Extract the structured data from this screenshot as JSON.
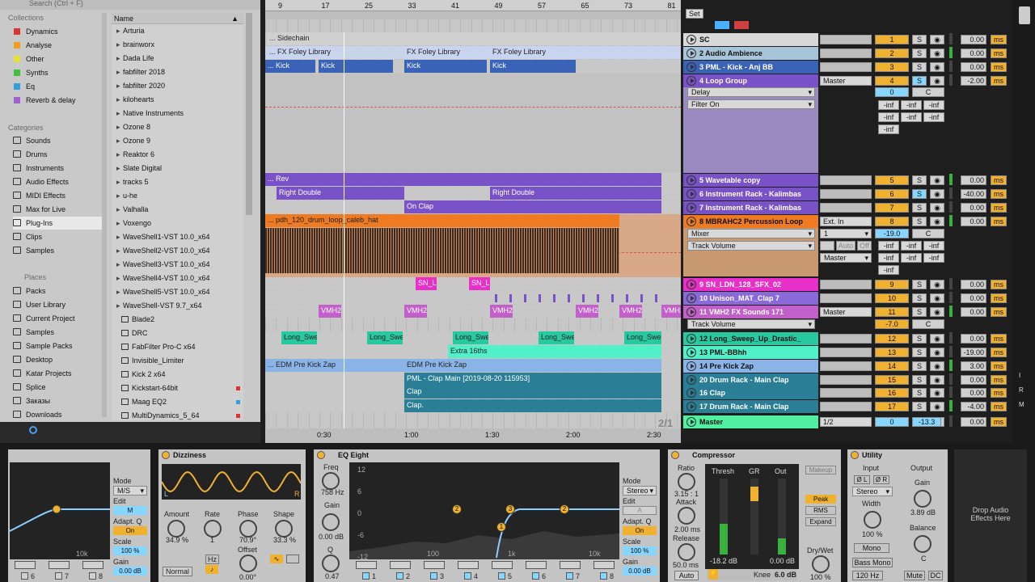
{
  "browser": {
    "search_placeholder": "Search (Ctrl + F)",
    "collections_title": "Collections",
    "collections": [
      {
        "label": "Dynamics",
        "color": "#e03030"
      },
      {
        "label": "Analyse",
        "color": "#f0a020"
      },
      {
        "label": "Other",
        "color": "#e8e030"
      },
      {
        "label": "Synths",
        "color": "#40c040"
      },
      {
        "label": "Eq",
        "color": "#30a0e0"
      },
      {
        "label": "Reverb & delay",
        "color": "#a060d0"
      }
    ],
    "categories_title": "Categories",
    "categories": [
      "Sounds",
      "Drums",
      "Instruments",
      "Audio Effects",
      "MIDI Effects",
      "Max for Live",
      "Plug-Ins",
      "Clips",
      "Samples"
    ],
    "selected_category": "Plug-Ins",
    "places_title": "Places",
    "places": [
      "Packs",
      "User Library",
      "Current Project",
      "Samples",
      "Sample Packs",
      "Desktop",
      "Katar Projects",
      "Splice",
      "Заказы",
      "Downloads"
    ],
    "name_header": "Name",
    "items": [
      {
        "label": "Arturia",
        "kind": "folder"
      },
      {
        "label": "brainworx",
        "kind": "folder"
      },
      {
        "label": "Dada Life",
        "kind": "folder"
      },
      {
        "label": "fabfilter 2018",
        "kind": "folder"
      },
      {
        "label": "fabfilter 2020",
        "kind": "folder"
      },
      {
        "label": "kilohearts",
        "kind": "folder"
      },
      {
        "label": "Native Instruments",
        "kind": "folder"
      },
      {
        "label": "Ozone 8",
        "kind": "folder"
      },
      {
        "label": "Ozone 9",
        "kind": "folder"
      },
      {
        "label": "Reaktor 6",
        "kind": "folder"
      },
      {
        "label": "Slate Digital",
        "kind": "folder"
      },
      {
        "label": "tracks 5",
        "kind": "folder"
      },
      {
        "label": "u-he",
        "kind": "folder"
      },
      {
        "label": "Valhalla",
        "kind": "folder"
      },
      {
        "label": "Voxengo",
        "kind": "folder"
      },
      {
        "label": "WaveShell1-VST 10.0_x64",
        "kind": "folder"
      },
      {
        "label": "WaveShell2-VST 10.0_x64",
        "kind": "folder"
      },
      {
        "label": "WaveShell3-VST 10.0_x64",
        "kind": "folder"
      },
      {
        "label": "WaveShell4-VST 10.0_x64",
        "kind": "folder"
      },
      {
        "label": "WaveShell5-VST 10.0_x64",
        "kind": "folder"
      },
      {
        "label": "WaveShell-VST 9.7_x64",
        "kind": "folder"
      },
      {
        "label": "Blade2",
        "kind": "plugin"
      },
      {
        "label": "DRC",
        "kind": "plugin"
      },
      {
        "label": "FabFilter Pro-C x64",
        "kind": "plugin"
      },
      {
        "label": "Invisible_Limiter",
        "kind": "plugin"
      },
      {
        "label": "Kick 2 x64",
        "kind": "plugin"
      },
      {
        "label": "Kickstart-64bit",
        "kind": "plugin",
        "dot": "#e03030"
      },
      {
        "label": "Maag EQ2",
        "kind": "plugin",
        "dot": "#30a0e0"
      },
      {
        "label": "MultiDynamics_5_64",
        "kind": "plugin",
        "dot": "#e03030"
      }
    ]
  },
  "arrangement": {
    "bars": [
      "9",
      "17",
      "25",
      "33",
      "41",
      "49",
      "57",
      "65",
      "73",
      "81"
    ],
    "times": [
      "0:30",
      "1:00",
      "1:30",
      "2:00",
      "2:30"
    ],
    "set_label": "Set",
    "loop_label": "2/1",
    "clips": [
      {
        "label": "... Sidechain",
        "lane": 0
      },
      {
        "label": "... FX Foley Library",
        "lane": 1
      },
      {
        "label": "FX Foley Library",
        "lane": 1
      },
      {
        "label": "FX Foley Library",
        "lane": 1
      },
      {
        "label": "... Kick",
        "lane": 2
      },
      {
        "label": "Kick",
        "lane": 2
      },
      {
        "label": "Kick",
        "lane": 2
      },
      {
        "label": "Kick",
        "lane": 2
      },
      {
        "label": "... Rev",
        "lane": 3
      },
      {
        "label": "Right Double",
        "lane": 4
      },
      {
        "label": "Right Double",
        "lane": 4
      },
      {
        "label": "On Clap",
        "lane": 5
      },
      {
        "label": "... pdh_120_drum_loop_caleb_hat",
        "lane": 6
      },
      {
        "label": "SN_LI",
        "lane": 7
      },
      {
        "label": "SN_LI",
        "lane": 7
      },
      {
        "label": "VMH2",
        "lane": 9
      },
      {
        "label": "VMH2",
        "lane": 9
      },
      {
        "label": "VMH2",
        "lane": 9
      },
      {
        "label": "VMH2",
        "lane": 9
      },
      {
        "label": "VMH2",
        "lane": 9
      },
      {
        "label": "VMH2",
        "lane": 9
      },
      {
        "label": "Long_Swe",
        "lane": 10
      },
      {
        "label": "Long_Swe",
        "lane": 10
      },
      {
        "label": "Long_Swe",
        "lane": 10
      },
      {
        "label": "Long_Swe",
        "lane": 10
      },
      {
        "label": "Long_Swe",
        "lane": 10
      },
      {
        "label": "Extra 16ths",
        "lane": 11
      },
      {
        "label": "... EDM Pre Kick Zap",
        "lane": 12
      },
      {
        "label": "EDM Pre Kick Zap",
        "lane": 12
      },
      {
        "label": "PML - Clap Main [2019-08-20 115953]",
        "lane": 13
      },
      {
        "label": "Clap",
        "lane": 14
      },
      {
        "label": "Clap.",
        "lane": 15
      }
    ]
  },
  "tracks": [
    {
      "name": "SC",
      "color": "#d8d8d8",
      "num": "1",
      "vol": "0.00"
    },
    {
      "name": "2 Audio Ambience",
      "color": "#a8c4d8",
      "num": "2",
      "vol": "0.00"
    },
    {
      "name": "3 PML - Kick - Anj BB",
      "color": "#3a63b8",
      "num": "3",
      "vol": "0.00"
    },
    {
      "name": "4 Loop Group",
      "color": "#7a52c8",
      "num": "4",
      "vol": "-2.00",
      "io": "Master"
    },
    {
      "name": "5 Wavetable copy",
      "color": "#7a52c8",
      "num": "5",
      "vol": "0.00"
    },
    {
      "name": "6 Instrument Rack - Kalimbas",
      "color": "#7a52c8",
      "num": "6",
      "vol": "-40.00"
    },
    {
      "name": "7 Instrument Rack - Kalimbas",
      "color": "#7a52c8",
      "num": "7",
      "vol": "0.00"
    },
    {
      "name": "8 MBRAHC2 Percussion Loop",
      "color": "#ee7a22",
      "num": "8",
      "vol": "0.00",
      "io": "Ext. In"
    },
    {
      "name": "9 SN_LDN_128_SFX_02",
      "color": "#e830c8",
      "num": "9",
      "vol": "0.00"
    },
    {
      "name": "10 Unison_MAT_Clap 7",
      "color": "#8a6ad8",
      "num": "10",
      "vol": "0.00"
    },
    {
      "name": "11 VMH2 FX Sounds 171",
      "color": "#c060c8",
      "num": "11",
      "vol": "0.00",
      "io": "Master"
    },
    {
      "name": "12 Long_Sweep_Up_Drastic_",
      "color": "#28c8a0",
      "num": "12",
      "vol": "0.00"
    },
    {
      "name": "13 PML-BBhh",
      "color": "#50f0c8",
      "num": "13",
      "vol": "-19.00"
    },
    {
      "name": "14 Pre Kick Zap",
      "color": "#8ab4e8",
      "num": "14",
      "vol": "3.00"
    },
    {
      "name": "20 Drum Rack - Main Clap",
      "color": "#2a7e96",
      "num": "15",
      "vol": "0.00"
    },
    {
      "name": "16 Clap",
      "color": "#2a7e96",
      "num": "16",
      "vol": "0.00"
    },
    {
      "name": "17 Drum Rack - Main Clap",
      "color": "#2a7e96",
      "num": "17",
      "vol": "-4.00"
    },
    {
      "name": "Master",
      "color": "#50f0a0",
      "num": "0",
      "vol": "0.00",
      "io": "1/2",
      "pan": "-13.3"
    }
  ],
  "group4": {
    "param1": "Delay",
    "param2": "Filter On",
    "send": "0",
    "pan": "C",
    "infs": [
      "-inf",
      "-inf",
      "-inf",
      "-inf",
      "-inf",
      "-inf",
      "-inf"
    ]
  },
  "group8": {
    "param1": "Mixer",
    "param2": "Track Volume",
    "io2": "1",
    "io3": "Master",
    "auto": "Auto",
    "off": "Off",
    "send": "-19.0",
    "pan": "C",
    "infs": [
      "-inf",
      "-inf",
      "-inf",
      "-inf",
      "-inf",
      "-inf",
      "-inf"
    ]
  },
  "group11": {
    "param1": "Track Volume",
    "send": "-7.0",
    "pan": "C"
  },
  "ms_label": "ms",
  "s_label": "S",
  "c_label": "C",
  "devices": {
    "eq_left": {
      "mode_label": "Mode",
      "mode": "M/S",
      "edit_label": "Edit",
      "edit": "M",
      "adapt_label": "Adapt. Q",
      "adapt": "On",
      "scale_label": "Scale",
      "scale": "100 %",
      "gain_label": "Gain",
      "gain": "0.00 dB",
      "freq_tick": "10k",
      "bands": [
        "6",
        "7",
        "8"
      ]
    },
    "dizziness": {
      "title": "Dizziness",
      "amount_label": "Amount",
      "amount": "34.9 %",
      "rate_label": "Rate",
      "rate": "1",
      "phase_label": "Phase",
      "phase": "70.9°",
      "shape_label": "Shape",
      "shape": "33.3 %",
      "offset_label": "Offset",
      "offset": "0.00°",
      "hz": "Hz",
      "mode": "Normal",
      "l": "L",
      "r": "R"
    },
    "eq_eight": {
      "title": "EQ Eight",
      "freq_label": "Freq",
      "freq": "758 Hz",
      "gain_label": "Gain",
      "gain": "0.00 dB",
      "q_label": "Q",
      "q": "0.47",
      "db_ticks": [
        "12",
        "6",
        "0",
        "-6",
        "-12"
      ],
      "freq_ticks": [
        "100",
        "1k",
        "10k"
      ],
      "mode_label": "Mode",
      "mode": "Stereo",
      "edit_label": "Edit",
      "edit": "A",
      "adapt_label": "Adapt. Q",
      "adapt": "On",
      "scale_label": "Scale",
      "scale": "100 %",
      "gain2_label": "Gain",
      "gain2": "0.00 dB",
      "bands": [
        "1",
        "2",
        "3",
        "4",
        "5",
        "6",
        "7",
        "8"
      ],
      "nodes": [
        "2",
        "3",
        "2",
        "1"
      ]
    },
    "compressor": {
      "title": "Compressor",
      "ratio_label": "Ratio",
      "ratio": "3.15 : 1",
      "attack_label": "Attack",
      "attack": "2.00 ms",
      "release_label": "Release",
      "release": "50.0 ms",
      "auto": "Auto",
      "thresh_label": "Thresh",
      "thresh": "-18.2 dB",
      "gr_label": "GR",
      "out_label": "Out",
      "out": "0.00 dB",
      "makeup": "Makeup",
      "peak": "Peak",
      "rms": "RMS",
      "expand": "Expand",
      "drywet_label": "Dry/Wet",
      "drywet": "100 %",
      "knee_label": "Knee",
      "knee": "6.0 dB"
    },
    "utility": {
      "title": "Utility",
      "input_label": "Input",
      "output_label": "Output",
      "phase_l": "Ø L",
      "phase_r": "Ø R",
      "channel": "Stereo",
      "width_label": "Width",
      "width": "100 %",
      "mono": "Mono",
      "bass_mono": "Bass Mono",
      "bass_freq": "120 Hz",
      "gain_label": "Gain",
      "gain": "3.89 dB",
      "balance_label": "Balance",
      "balance": "C",
      "mute": "Mute",
      "dc": "DC"
    },
    "drop_hint": "Drop Audio Effects Here"
  }
}
